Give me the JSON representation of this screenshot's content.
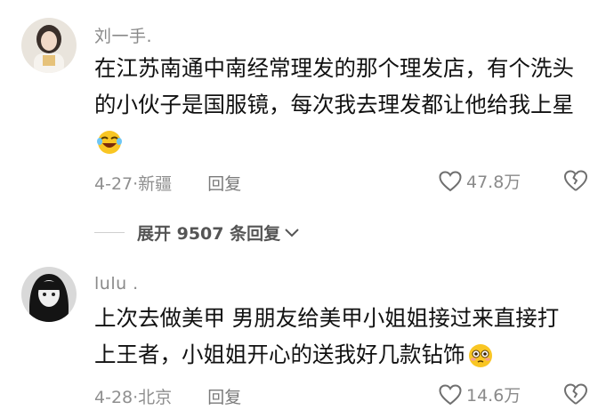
{
  "comments": [
    {
      "username": "刘一手.",
      "lines": [
        "在江苏南通中南经常理发的那个理发店，有个洗头",
        "的小伙子是国服镜，每次我去理发都让他给我上星"
      ],
      "emoji": "laughing-crying-emoji",
      "date_location": "4-27·新疆",
      "reply_label": "回复",
      "likes": "47.8万"
    },
    {
      "username": "lulu .",
      "lines": [
        "上次去做美甲 男朋友给美甲小姐姐接过来直接打",
        "上王者，小姐姐开心的送我好几款钻饰"
      ],
      "emoji": "flushed-face-emoji",
      "date_location": "4-28·北京",
      "reply_label": "回复",
      "likes": "14.6万"
    }
  ],
  "expand_replies": "展开 9507 条回复",
  "icons": {
    "like": "heart-outline-icon",
    "dislike": "broken-heart-icon",
    "expand": "chevron-down-icon"
  },
  "colors": {
    "text": "#111111",
    "meta": "#8f8f8f",
    "background": "#ffffff"
  }
}
